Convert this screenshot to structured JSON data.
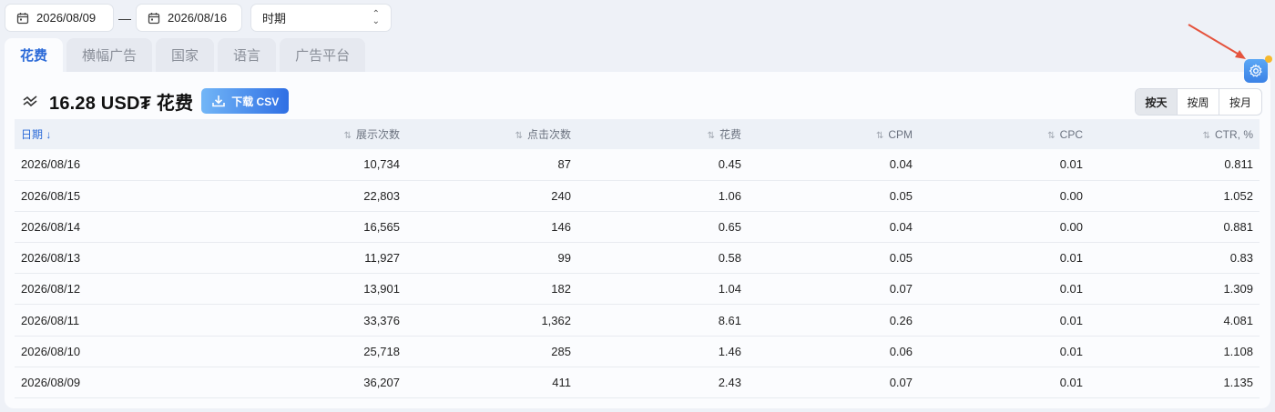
{
  "filters": {
    "start_date": "2026/08/09",
    "separator": "—",
    "end_date": "2026/08/16",
    "period_select": "时期"
  },
  "tabs": [
    "花费",
    "横幅广告",
    "国家",
    "语言",
    "广告平台"
  ],
  "active_tab_index": 0,
  "summary": {
    "total": "16.28 USD₮ 花费",
    "csv_button": "下载 CSV"
  },
  "granularity": [
    "按天",
    "按周",
    "按月"
  ],
  "active_granularity": 0,
  "table": {
    "columns": [
      "日期",
      "展示次数",
      "点击次数",
      "花费",
      "CPM",
      "CPC",
      "CTR, %"
    ],
    "rows": [
      [
        "2026/08/16",
        "10,734",
        "87",
        "0.45",
        "0.04",
        "0.01",
        "0.811"
      ],
      [
        "2026/08/15",
        "22,803",
        "240",
        "1.06",
        "0.05",
        "0.00",
        "1.052"
      ],
      [
        "2026/08/14",
        "16,565",
        "146",
        "0.65",
        "0.04",
        "0.00",
        "0.881"
      ],
      [
        "2026/08/13",
        "11,927",
        "99",
        "0.58",
        "0.05",
        "0.01",
        "0.83"
      ],
      [
        "2026/08/12",
        "13,901",
        "182",
        "1.04",
        "0.07",
        "0.01",
        "1.309"
      ],
      [
        "2026/08/11",
        "33,376",
        "1,362",
        "8.61",
        "0.26",
        "0.01",
        "4.081"
      ],
      [
        "2026/08/10",
        "25,718",
        "285",
        "1.46",
        "0.06",
        "0.01",
        "1.108"
      ],
      [
        "2026/08/09",
        "36,207",
        "411",
        "2.43",
        "0.07",
        "0.01",
        "1.135"
      ]
    ]
  },
  "colors": {
    "accent": "#2b6ad8",
    "annotation_arrow": "#e5533d",
    "badge_dot": "#f5b82e"
  }
}
